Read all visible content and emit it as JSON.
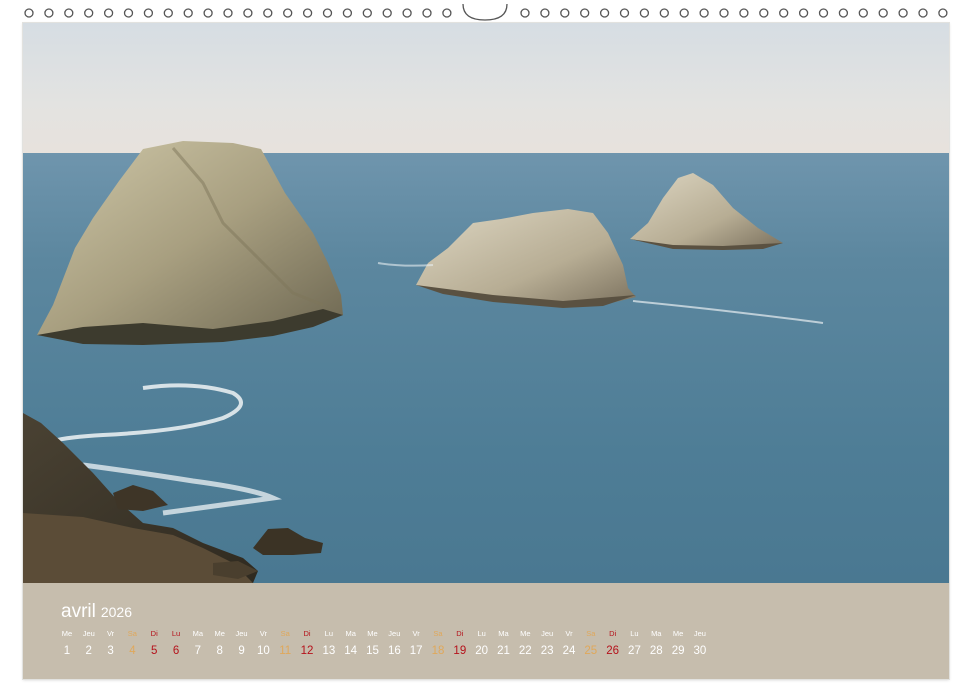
{
  "calendar": {
    "month": "avril",
    "year": "2026",
    "days": [
      {
        "dow": "Me",
        "num": "1",
        "kind": "weekday"
      },
      {
        "dow": "Jeu",
        "num": "2",
        "kind": "weekday"
      },
      {
        "dow": "Vr",
        "num": "3",
        "kind": "weekday"
      },
      {
        "dow": "Sa",
        "num": "4",
        "kind": "sat"
      },
      {
        "dow": "Di",
        "num": "5",
        "kind": "sun"
      },
      {
        "dow": "Lu",
        "num": "6",
        "kind": "hol"
      },
      {
        "dow": "Ma",
        "num": "7",
        "kind": "weekday"
      },
      {
        "dow": "Me",
        "num": "8",
        "kind": "weekday"
      },
      {
        "dow": "Jeu",
        "num": "9",
        "kind": "weekday"
      },
      {
        "dow": "Vr",
        "num": "10",
        "kind": "weekday"
      },
      {
        "dow": "Sa",
        "num": "11",
        "kind": "sat"
      },
      {
        "dow": "Di",
        "num": "12",
        "kind": "sun"
      },
      {
        "dow": "Lu",
        "num": "13",
        "kind": "weekday"
      },
      {
        "dow": "Ma",
        "num": "14",
        "kind": "weekday"
      },
      {
        "dow": "Me",
        "num": "15",
        "kind": "weekday"
      },
      {
        "dow": "Jeu",
        "num": "16",
        "kind": "weekday"
      },
      {
        "dow": "Vr",
        "num": "17",
        "kind": "weekday"
      },
      {
        "dow": "Sa",
        "num": "18",
        "kind": "sat"
      },
      {
        "dow": "Di",
        "num": "19",
        "kind": "sun"
      },
      {
        "dow": "Lu",
        "num": "20",
        "kind": "weekday"
      },
      {
        "dow": "Ma",
        "num": "21",
        "kind": "weekday"
      },
      {
        "dow": "Me",
        "num": "22",
        "kind": "weekday"
      },
      {
        "dow": "Jeu",
        "num": "23",
        "kind": "weekday"
      },
      {
        "dow": "Vr",
        "num": "24",
        "kind": "weekday"
      },
      {
        "dow": "Sa",
        "num": "25",
        "kind": "sat"
      },
      {
        "dow": "Di",
        "num": "26",
        "kind": "sun"
      },
      {
        "dow": "Lu",
        "num": "27",
        "kind": "weekday"
      },
      {
        "dow": "Ma",
        "num": "28",
        "kind": "weekday"
      },
      {
        "dow": "Me",
        "num": "29",
        "kind": "weekday"
      },
      {
        "dow": "Jeu",
        "num": "30",
        "kind": "weekday"
      }
    ]
  },
  "colors": {
    "calendar_bar": "#c4baaa",
    "saturday": "#e0a85a",
    "sunday_holiday": "#b5121b",
    "sea": "#4f7f9a",
    "sky": "#dfe3e6"
  }
}
